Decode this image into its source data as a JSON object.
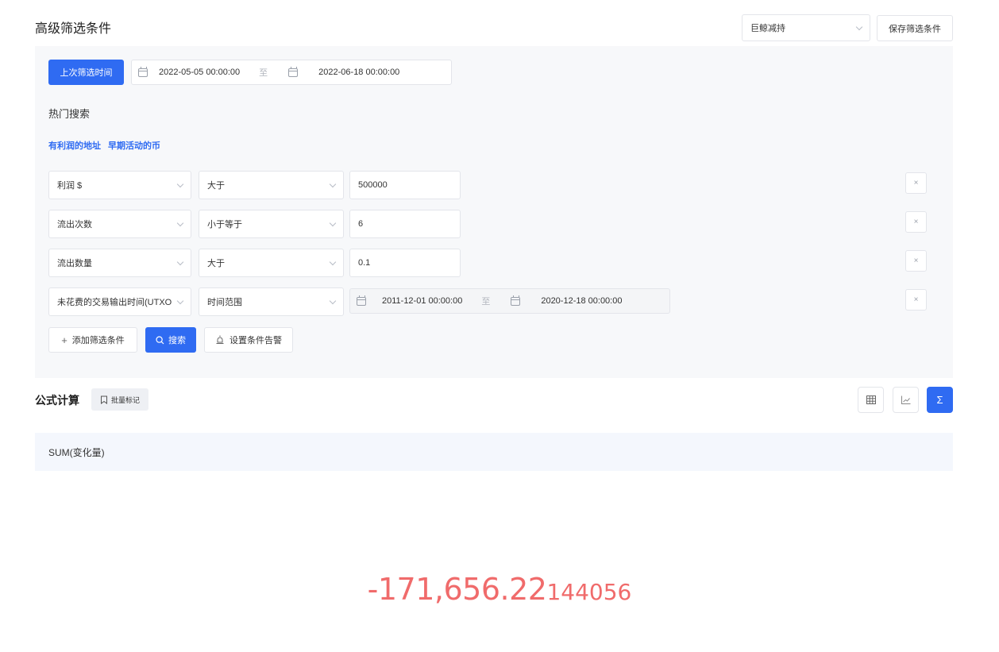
{
  "header": {
    "title": "高级筛选条件",
    "preset_value": "巨鲸减持",
    "save_label": "保存筛选条件"
  },
  "filter": {
    "last_time_label": "上次筛选时间",
    "last_time_range": {
      "start": "2022-05-05 00:00:00",
      "sep": "至",
      "end": "2022-06-18 00:00:00"
    },
    "hot_search_label": "热门搜索",
    "hot_links": [
      "有利润的地址",
      "早期活动的币"
    ],
    "conditions": [
      {
        "field": "利润 $",
        "operator": "大于",
        "value": "500000",
        "remove": "×"
      },
      {
        "field": "流出次数",
        "operator": "小于等于",
        "value": "6",
        "remove": "×"
      },
      {
        "field": "流出数量",
        "operator": "大于",
        "value": "0.1",
        "remove": "×"
      },
      {
        "field": "未花费的交易输出时间(UTXO)",
        "operator": "时间范围",
        "range": {
          "start": "2011-12-01 00:00:00",
          "sep": "至",
          "end": "2020-12-18 00:00:00"
        },
        "remove": "×"
      }
    ],
    "add_label": "添加筛选条件",
    "search_label": "搜索",
    "alert_label": "设置条件告警"
  },
  "formula": {
    "title": "公式计算",
    "batch_label": "批量标记",
    "expression": "SUM(变化量)",
    "result_main": "-171,656.22",
    "result_tail": "144056",
    "result_color": "#f06b6b",
    "views": [
      "table-icon",
      "line-chart-icon",
      "sigma-icon"
    ],
    "active_view": "sigma-icon"
  }
}
